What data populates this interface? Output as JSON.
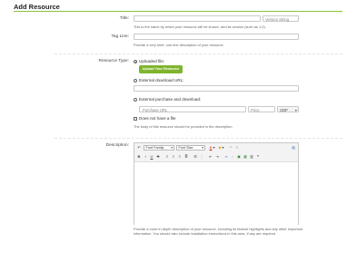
{
  "page": {
    "title": "Add Resource"
  },
  "title_field": {
    "label": "Title:",
    "value": "",
    "version_placeholder": "Version String",
    "hint": "This is the name by which your resource will be known, and its version (such as 1.0)."
  },
  "tagline_field": {
    "label": "Tag Line:",
    "value": "",
    "hint": "Provide a very brief, one-line description of your resource."
  },
  "resource_type": {
    "label": "Resource Type:",
    "options": [
      {
        "label": "Uploaded file:",
        "selected": true
      },
      {
        "label": "External download URL:",
        "selected": false
      },
      {
        "label": "External purchase and download:",
        "selected": false
      }
    ],
    "upload_button": "Upload Your Resource",
    "purchase_url_placeholder": "Purchase URL",
    "price_placeholder": "Price",
    "currency": "GBP",
    "no_file_label": "Does not have a file",
    "no_file_hint": "The body of this resource should be provided in the description."
  },
  "description": {
    "label": "Description:",
    "toolbar": {
      "font_family": "Font Family",
      "font_size": "Font Size"
    },
    "hint": "Provide a more in-depth description of your resource, including its feature highlights and any other important information. You should also include installation instructions in this area, if any are required."
  },
  "colors": {
    "accent": "#8fc13f",
    "button": "#7fb52e"
  }
}
